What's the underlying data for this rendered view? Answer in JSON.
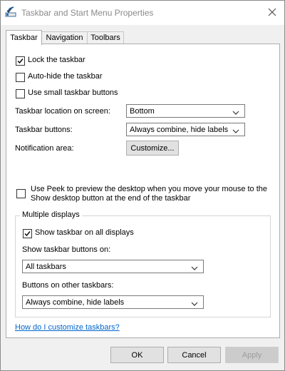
{
  "window": {
    "title": "Taskbar and Start Menu Properties",
    "icons": {
      "app": "taskbar-properties-icon",
      "close": "close-icon"
    }
  },
  "tabs": [
    {
      "label": "Taskbar",
      "active": true
    },
    {
      "label": "Navigation",
      "active": false
    },
    {
      "label": "Toolbars",
      "active": false
    }
  ],
  "taskbar": {
    "lock": {
      "label": "Lock the taskbar",
      "checked": true
    },
    "autohide": {
      "label": "Auto-hide the taskbar",
      "checked": false
    },
    "small_buttons": {
      "label": "Use small taskbar buttons",
      "checked": false
    },
    "location": {
      "label": "Taskbar location on screen:",
      "value": "Bottom"
    },
    "buttons": {
      "label": "Taskbar buttons:",
      "value": "Always combine, hide labels"
    },
    "notification": {
      "label": "Notification area:",
      "button": "Customize..."
    },
    "peek": {
      "label": "Use Peek to preview the desktop when you move your mouse to the Show desktop button at the end of the taskbar",
      "checked": false
    },
    "multiple_displays": {
      "title": "Multiple displays",
      "show_all": {
        "label": "Show taskbar on all displays",
        "checked": true
      },
      "show_buttons_on": {
        "label": "Show taskbar buttons on:",
        "value": "All taskbars"
      },
      "other_buttons": {
        "label": "Buttons on other taskbars:",
        "value": "Always combine, hide labels"
      }
    },
    "help_link": "How do I customize taskbars?"
  },
  "footer": {
    "ok": "OK",
    "cancel": "Cancel",
    "apply": "Apply",
    "apply_enabled": false
  },
  "colors": {
    "link": "#0066cc",
    "disabled_text": "#9d9d9d",
    "title_text": "#8a8a8a"
  }
}
